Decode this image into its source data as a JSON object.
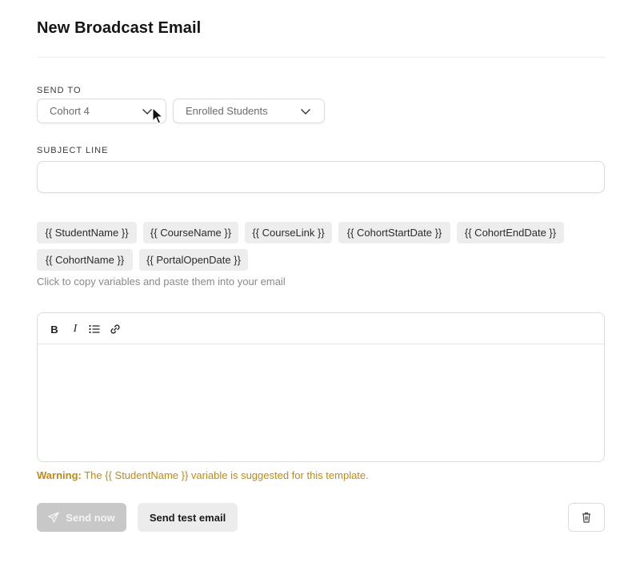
{
  "page": {
    "title": "New Broadcast Email"
  },
  "send_to": {
    "label": "SEND TO",
    "cohort_select": {
      "value": "Cohort 4"
    },
    "audience_select": {
      "value": "Enrolled Students"
    }
  },
  "subject": {
    "label": "SUBJECT LINE",
    "value": "",
    "placeholder": ""
  },
  "variables": {
    "chips": [
      "{{ StudentName }}",
      "{{ CourseName }}",
      "{{ CourseLink }}",
      "{{ CohortStartDate }}",
      "{{ CohortEndDate }}",
      "{{ CohortName }}",
      "{{ PortalOpenDate }}"
    ],
    "hint": "Click to copy variables and paste them into your email"
  },
  "editor": {
    "toolbar": {
      "bold": "B",
      "italic": "I",
      "list_icon": "bullet-list-icon",
      "link_icon": "link-icon"
    },
    "body": ""
  },
  "warning": {
    "prefix": "Warning:",
    "message": " The {{ StudentName }} variable is suggested for this template."
  },
  "actions": {
    "send_now": "Send now",
    "send_test": "Send test email",
    "delete_icon": "trash-icon"
  },
  "colors": {
    "warning": "#c08a14",
    "disabled_button": "#c8c8c8",
    "chip_bg": "#ededed"
  }
}
